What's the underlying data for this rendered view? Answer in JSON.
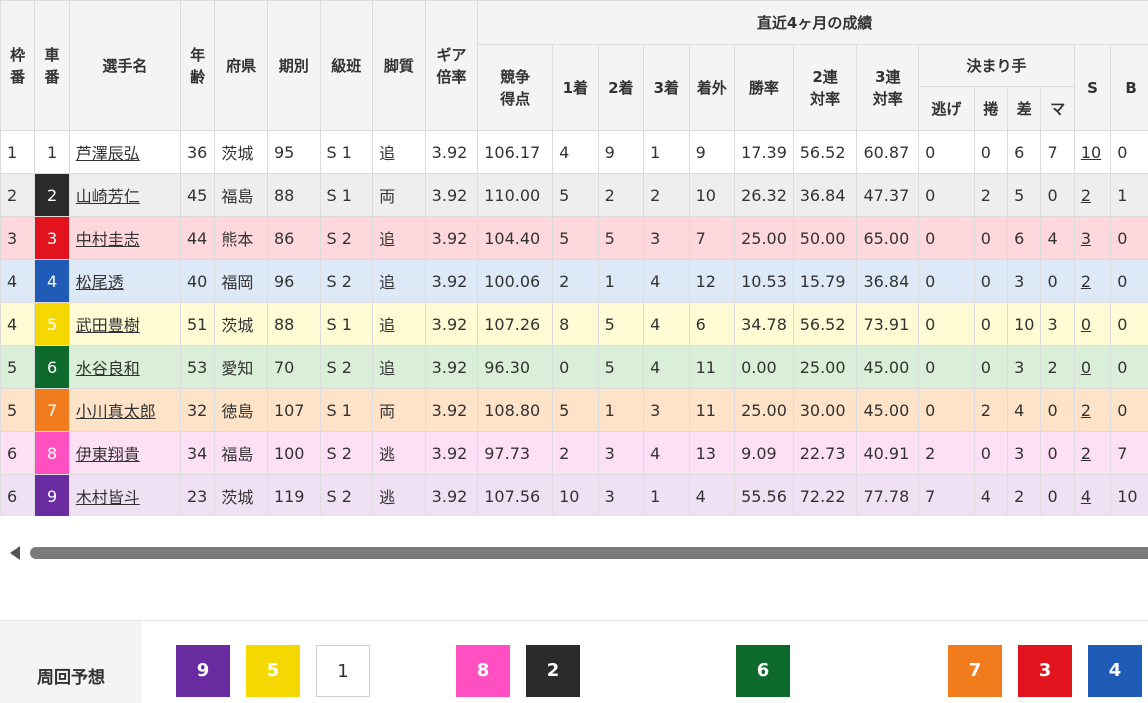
{
  "headers": {
    "waku": "枠番",
    "car": "車番",
    "name": "選手名",
    "age": "年齢",
    "pref": "府県",
    "term": "期別",
    "class": "級班",
    "style": "脚質",
    "gear": "ギア倍率",
    "recent_group": "直近4ヶ月の成績",
    "score": "競争得点",
    "first": "1着",
    "second": "2着",
    "third": "3着",
    "outside": "着外",
    "win_rate": "勝率",
    "rate2": "2連対率",
    "rate3": "3連対率",
    "decide_group": "決まり手",
    "nige": "逃げ",
    "makuri": "捲",
    "sashi": "差",
    "mark": "マ",
    "s": "S",
    "b": "B"
  },
  "riders": [
    {
      "waku": "1",
      "car": "1",
      "name": "芦澤辰弘",
      "age": "36",
      "pref": "茨城",
      "term": "95",
      "class": "S 1",
      "style": "追",
      "gear": "3.92",
      "score": "106.17",
      "first": "4",
      "second": "9",
      "third": "1",
      "outside": "9",
      "win_rate": "17.39",
      "rate2": "56.52",
      "rate3": "60.87",
      "nige": "0",
      "makuri": "0",
      "sashi": "6",
      "mark": "7",
      "s": "10",
      "b": "0"
    },
    {
      "waku": "2",
      "car": "2",
      "name": "山崎芳仁",
      "age": "45",
      "pref": "福島",
      "term": "88",
      "class": "S 1",
      "style": "両",
      "gear": "3.92",
      "score": "110.00",
      "first": "5",
      "second": "2",
      "third": "2",
      "outside": "10",
      "win_rate": "26.32",
      "rate2": "36.84",
      "rate3": "47.37",
      "nige": "0",
      "makuri": "2",
      "sashi": "5",
      "mark": "0",
      "s": "2",
      "b": "1"
    },
    {
      "waku": "3",
      "car": "3",
      "name": "中村圭志",
      "age": "44",
      "pref": "熊本",
      "term": "86",
      "class": "S 2",
      "style": "追",
      "gear": "3.92",
      "score": "104.40",
      "first": "5",
      "second": "5",
      "third": "3",
      "outside": "7",
      "win_rate": "25.00",
      "rate2": "50.00",
      "rate3": "65.00",
      "nige": "0",
      "makuri": "0",
      "sashi": "6",
      "mark": "4",
      "s": "3",
      "b": "0"
    },
    {
      "waku": "4",
      "car": "4",
      "name": "松尾透",
      "age": "40",
      "pref": "福岡",
      "term": "96",
      "class": "S 2",
      "style": "追",
      "gear": "3.92",
      "score": "100.06",
      "first": "2",
      "second": "1",
      "third": "4",
      "outside": "12",
      "win_rate": "10.53",
      "rate2": "15.79",
      "rate3": "36.84",
      "nige": "0",
      "makuri": "0",
      "sashi": "3",
      "mark": "0",
      "s": "2",
      "b": "0"
    },
    {
      "waku": "4",
      "car": "5",
      "name": "武田豊樹",
      "age": "51",
      "pref": "茨城",
      "term": "88",
      "class": "S 1",
      "style": "追",
      "gear": "3.92",
      "score": "107.26",
      "first": "8",
      "second": "5",
      "third": "4",
      "outside": "6",
      "win_rate": "34.78",
      "rate2": "56.52",
      "rate3": "73.91",
      "nige": "0",
      "makuri": "0",
      "sashi": "10",
      "mark": "3",
      "s": "0",
      "b": "0"
    },
    {
      "waku": "5",
      "car": "6",
      "name": "水谷良和",
      "age": "53",
      "pref": "愛知",
      "term": "70",
      "class": "S 2",
      "style": "追",
      "gear": "3.92",
      "score": "96.30",
      "first": "0",
      "second": "5",
      "third": "4",
      "outside": "11",
      "win_rate": "0.00",
      "rate2": "25.00",
      "rate3": "45.00",
      "nige": "0",
      "makuri": "0",
      "sashi": "3",
      "mark": "2",
      "s": "0",
      "b": "0"
    },
    {
      "waku": "5",
      "car": "7",
      "name": "小川真太郎",
      "age": "32",
      "pref": "徳島",
      "term": "107",
      "class": "S 1",
      "style": "両",
      "gear": "3.92",
      "score": "108.80",
      "first": "5",
      "second": "1",
      "third": "3",
      "outside": "11",
      "win_rate": "25.00",
      "rate2": "30.00",
      "rate3": "45.00",
      "nige": "0",
      "makuri": "2",
      "sashi": "4",
      "mark": "0",
      "s": "2",
      "b": "0"
    },
    {
      "waku": "6",
      "car": "8",
      "name": "伊東翔貴",
      "age": "34",
      "pref": "福島",
      "term": "100",
      "class": "S 2",
      "style": "逃",
      "gear": "3.92",
      "score": "97.73",
      "first": "2",
      "second": "3",
      "third": "4",
      "outside": "13",
      "win_rate": "9.09",
      "rate2": "22.73",
      "rate3": "40.91",
      "nige": "2",
      "makuri": "0",
      "sashi": "3",
      "mark": "0",
      "s": "2",
      "b": "7"
    },
    {
      "waku": "6",
      "car": "9",
      "name": "木村皆斗",
      "age": "23",
      "pref": "茨城",
      "term": "119",
      "class": "S 2",
      "style": "逃",
      "gear": "3.92",
      "score": "107.56",
      "first": "10",
      "second": "3",
      "third": "1",
      "outside": "4",
      "win_rate": "55.56",
      "rate2": "72.22",
      "rate3": "77.78",
      "nige": "7",
      "makuri": "4",
      "sashi": "2",
      "mark": "0",
      "s": "4",
      "b": "10"
    }
  ],
  "prediction": {
    "label": "周回予想",
    "boxes": [
      "9",
      "5",
      "1",
      "8",
      "2",
      "6",
      "7",
      "3",
      "4"
    ]
  },
  "colors": {
    "car1": "#ffffff",
    "car2": "#2b2b2b",
    "car3": "#e2131c",
    "car4": "#1f5bb7",
    "car5": "#f5d800",
    "car6": "#0d6a2c",
    "car7": "#f07c1d",
    "car8": "#ff4fc1",
    "car9": "#6a2aa0"
  }
}
